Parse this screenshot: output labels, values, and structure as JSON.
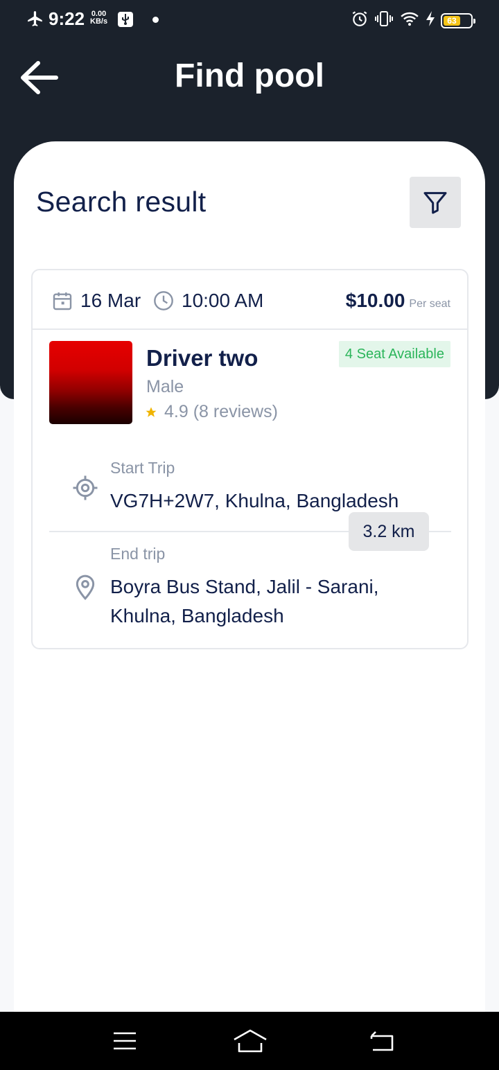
{
  "status_bar": {
    "time": "9:22",
    "net_speed": "0.00",
    "net_unit": "KB/s",
    "battery": "63",
    "battery_level": 0.63,
    "icons": [
      "airplane-icon",
      "usb-icon",
      "alarm-icon",
      "vibrate-icon",
      "wifi-icon",
      "charging-icon",
      "battery-icon"
    ]
  },
  "header": {
    "title": "Find pool",
    "back_icon": "arrow-left-icon"
  },
  "results": {
    "title": "Search result",
    "filter_icon": "filter-icon"
  },
  "ride": {
    "date": "16 Mar",
    "time": "10:00 AM",
    "price": "$10.00",
    "price_unit": "Per seat",
    "driver": {
      "name": "Driver two",
      "gender": "Male",
      "rating": "4.9 (8 reviews)"
    },
    "seats": "4 Seat Available",
    "start_label": "Start Trip",
    "start_address": "VG7H+2W7, Khulna, Bangladesh",
    "distance": "3.2 km",
    "end_label": "End trip",
    "end_address": "Boyra Bus Stand, Jalil - Sarani, Khulna, Bangladesh"
  },
  "colors": {
    "header_bg": "#1b222c",
    "text_primary": "#12204a",
    "text_muted": "#8a94a6",
    "badge_green": "#2bb55a",
    "badge_bg": "#e3f6ea",
    "star": "#f0b400"
  },
  "nav_bar": {
    "icons": [
      "menu-icon",
      "home-icon",
      "back-icon"
    ]
  }
}
